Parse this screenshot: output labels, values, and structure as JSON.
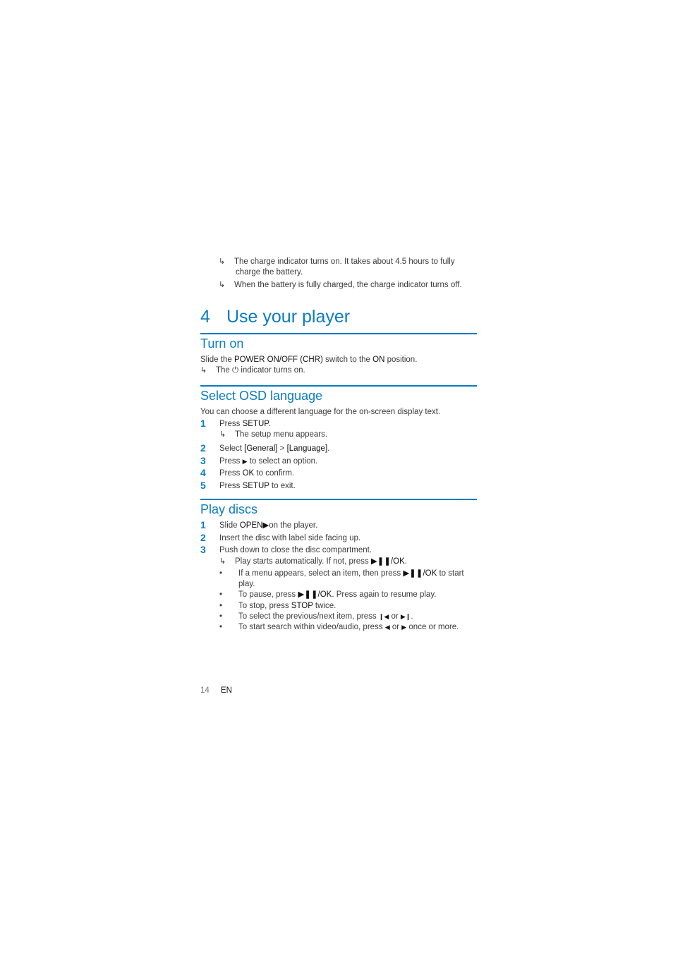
{
  "intro_results": [
    {
      "icon": "result-arrow-icon",
      "line1": "The charge indicator turns on. It takes about 4.5 hours to fully",
      "line2": "charge the battery."
    },
    {
      "icon": "result-arrow-icon",
      "line1": "When the battery is fully charged, the charge indicator turns off."
    }
  ],
  "chapter": {
    "number": "4",
    "title": "Use your player"
  },
  "turn_on": {
    "heading": "Turn on",
    "text_pre": "Slide the ",
    "text_b1": "POWER ON/OFF (CHR)",
    "text_mid": " switch to the ",
    "text_b2": "ON",
    "text_post": " position.",
    "result_pre": "The ",
    "result_symbol": "⏻",
    "result_post": " indicator turns on."
  },
  "osd": {
    "heading": "Select OSD language",
    "intro": "You can choose a different language for the on-screen display text.",
    "steps": [
      {
        "n": "1",
        "pre": "Press ",
        "bold": "SETUP",
        "post": ".",
        "result": "The setup menu appears."
      },
      {
        "n": "2",
        "pre": "Select ",
        "bold": "[General]",
        "mid": " > ",
        "bold2": "[Language]",
        "post": "."
      },
      {
        "n": "3",
        "pre": "Press ",
        "symbol": "▶",
        "post": " to select an option."
      },
      {
        "n": "4",
        "pre": "Press ",
        "bold": "OK",
        "post": " to confirm."
      },
      {
        "n": "5",
        "pre": "Press ",
        "bold": "SETUP",
        "post": " to exit."
      }
    ]
  },
  "play": {
    "heading": "Play discs",
    "steps": [
      {
        "n": "1",
        "pre": "Slide ",
        "bold": "OPEN▶",
        "post": "on the player."
      },
      {
        "n": "2",
        "text": "Insert the disc with label side facing up."
      },
      {
        "n": "3",
        "text": "Push down to close the disc compartment."
      }
    ],
    "result_pre": "Play starts automatically. If not, press ",
    "result_bold": "▶❚❚/OK",
    "result_post": ".",
    "bullets": [
      {
        "pre": "If a menu appears, select an item, then press ",
        "bold": "▶❚❚/OK",
        "post": " to start",
        "line2": "play."
      },
      {
        "pre": "To pause, press ",
        "bold": "▶❚❚/OK",
        "post": ". Press again to resume play."
      },
      {
        "pre": "To stop, press ",
        "bold": "STOP",
        "post": " twice."
      },
      {
        "pre": "To select the previous/next item, press ",
        "bold": "❙◀",
        "mid": " or ",
        "bold2": "▶❙",
        "post": "."
      },
      {
        "pre": "To start search within video/audio, press ",
        "bold": "◀",
        "mid": " or ",
        "bold2": "▶",
        "post": " once or more."
      }
    ],
    "bullet_char": "•"
  },
  "footer": {
    "page": "14",
    "lang": "EN"
  },
  "arrow_glyph": "↳"
}
